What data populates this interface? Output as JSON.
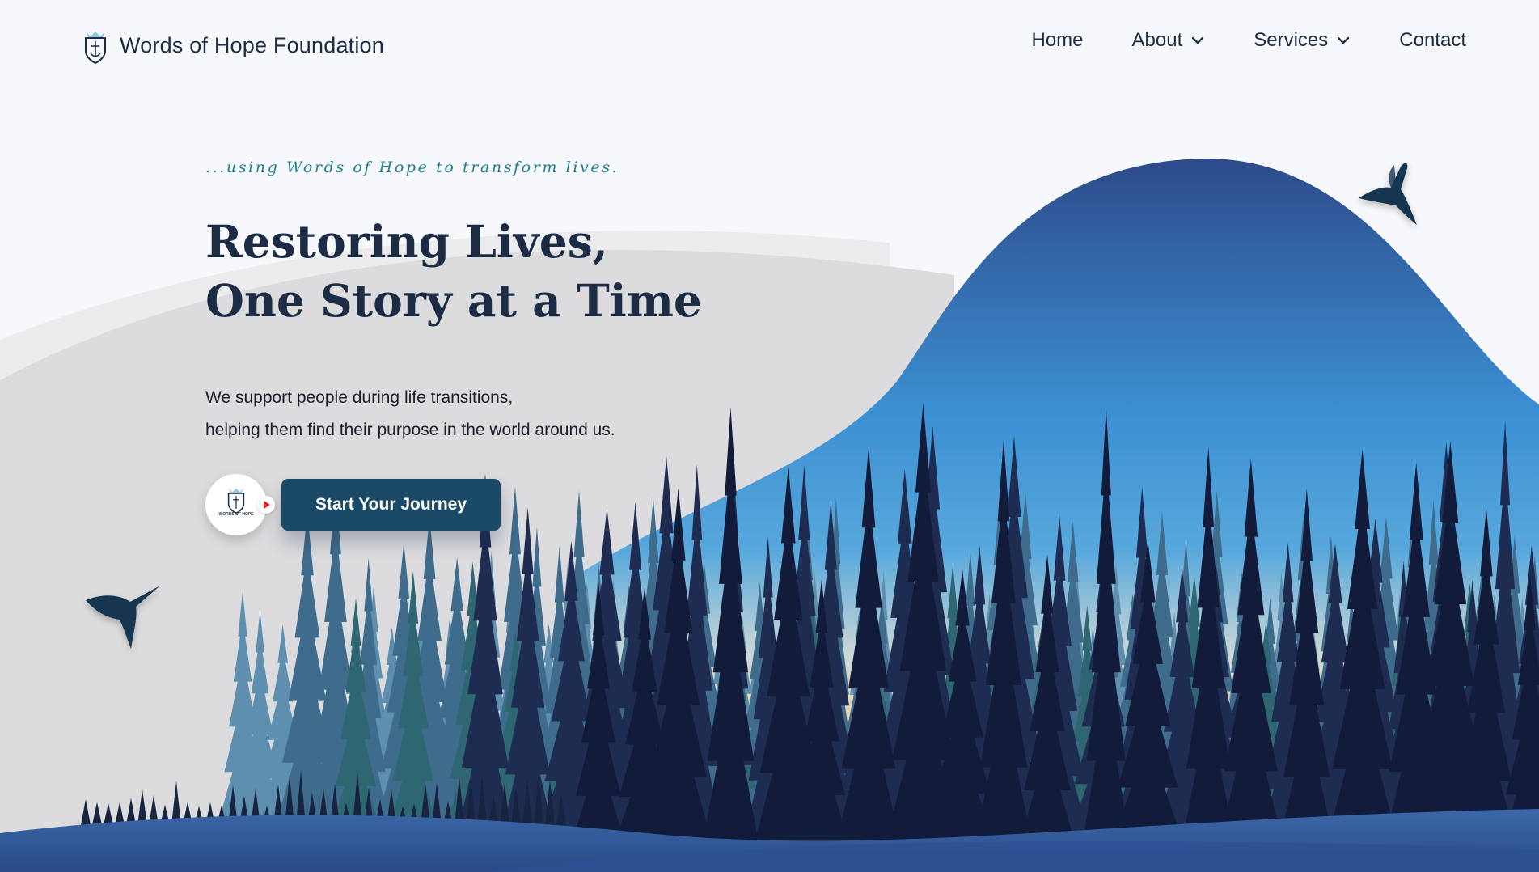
{
  "brand": {
    "name": "Words of Hope Foundation",
    "logo_icon": "shield-dove-icon"
  },
  "nav": {
    "items": [
      {
        "label": "Home",
        "has_dropdown": false
      },
      {
        "label": "About",
        "has_dropdown": true
      },
      {
        "label": "Services",
        "has_dropdown": true
      },
      {
        "label": "Contact",
        "has_dropdown": false
      }
    ]
  },
  "hero": {
    "tagline": "...using Words of Hope to transform lives.",
    "headline_line1": "Restoring Lives,",
    "headline_line2": "One Story at a Time",
    "description_line1": "We support people during life transitions,",
    "description_line2": "helping them find their purpose in the world around us.",
    "cta_label": "Start Your Journey",
    "video_thumb_label": "WORDS OF HOPE"
  },
  "colors": {
    "text_dark": "#1c2c44",
    "accent_teal": "#1e7f94",
    "cta_bg": "#1b4a66",
    "sky_top": "#2f4f8f",
    "sky_mid": "#3a97d8",
    "sky_glow": "#e8d5b5",
    "tree_front": "#121c3a",
    "tree_teal": "#2e6672",
    "tree_mid": "#3f6b8c"
  }
}
